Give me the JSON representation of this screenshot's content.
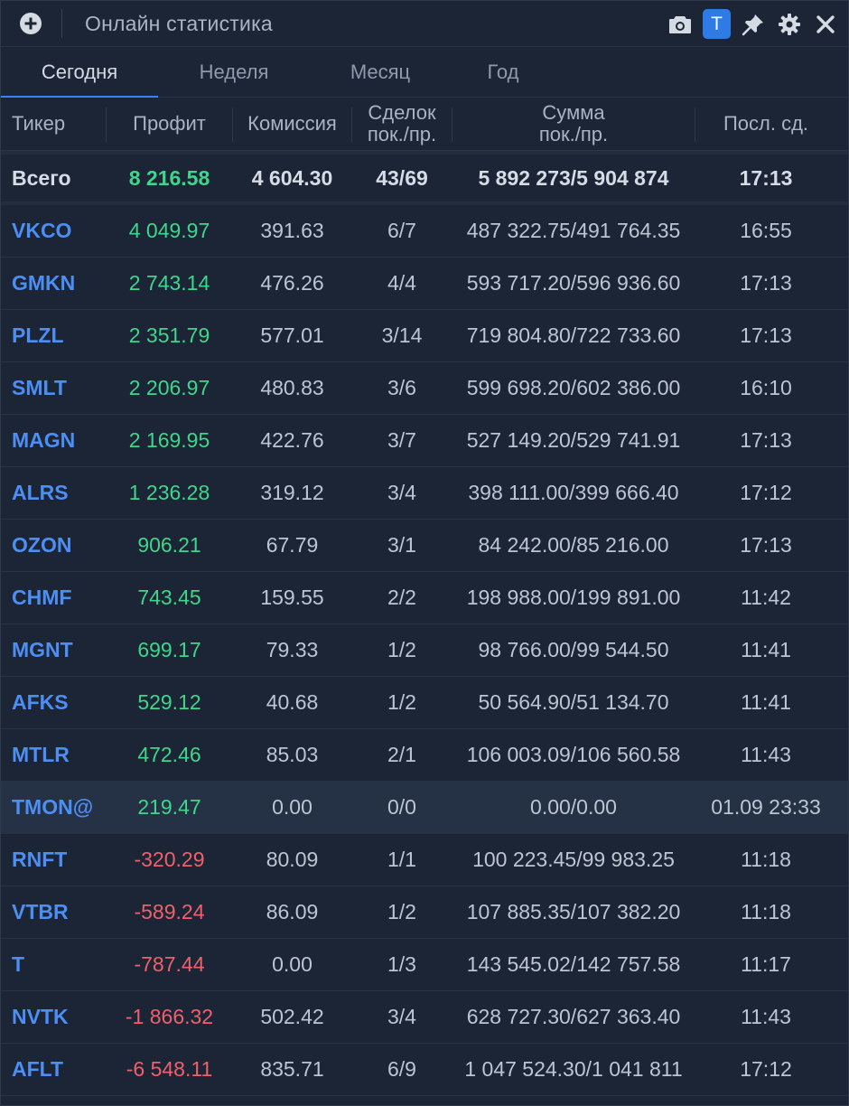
{
  "window": {
    "title": "Онлайн статистика",
    "t_badge": "T"
  },
  "icons": {
    "add": "plus-circle-icon",
    "camera": "camera-icon",
    "pin": "pin-icon",
    "settings": "gear-icon",
    "close": "close-icon"
  },
  "tabs": [
    {
      "label": "Сегодня",
      "active": true
    },
    {
      "label": "Неделя",
      "active": false
    },
    {
      "label": "Месяц",
      "active": false
    },
    {
      "label": "Год",
      "active": false
    }
  ],
  "columns": {
    "ticker": "Тикер",
    "profit": "Профит",
    "commission": "Комиссия",
    "deals_1": "Сделок",
    "deals_2": "пок./пр.",
    "sum_1": "Сумма",
    "sum_2": "пок./пр.",
    "last": "Посл. сд."
  },
  "total": {
    "ticker": "Всего",
    "profit": "8 216.58",
    "commission": "4 604.30",
    "deals": "43/69",
    "sum": "5 892 273/5 904 874",
    "last": "17:13"
  },
  "rows": [
    {
      "ticker": "VKCO",
      "profit": "4 049.97",
      "commission": "391.63",
      "deals": "6/7",
      "sum": "487 322.75/491 764.35",
      "last": "16:55"
    },
    {
      "ticker": "GMKN",
      "profit": "2 743.14",
      "commission": "476.26",
      "deals": "4/4",
      "sum": "593 717.20/596 936.60",
      "last": "17:13"
    },
    {
      "ticker": "PLZL",
      "profit": "2 351.79",
      "commission": "577.01",
      "deals": "3/14",
      "sum": "719 804.80/722 733.60",
      "last": "17:13"
    },
    {
      "ticker": "SMLT",
      "profit": "2 206.97",
      "commission": "480.83",
      "deals": "3/6",
      "sum": "599 698.20/602 386.00",
      "last": "16:10"
    },
    {
      "ticker": "MAGN",
      "profit": "2 169.95",
      "commission": "422.76",
      "deals": "3/7",
      "sum": "527 149.20/529 741.91",
      "last": "17:13"
    },
    {
      "ticker": "ALRS",
      "profit": "1 236.28",
      "commission": "319.12",
      "deals": "3/4",
      "sum": "398 111.00/399 666.40",
      "last": "17:12"
    },
    {
      "ticker": "OZON",
      "profit": "906.21",
      "commission": "67.79",
      "deals": "3/1",
      "sum": "84 242.00/85 216.00",
      "last": "17:13"
    },
    {
      "ticker": "CHMF",
      "profit": "743.45",
      "commission": "159.55",
      "deals": "2/2",
      "sum": "198 988.00/199 891.00",
      "last": "11:42"
    },
    {
      "ticker": "MGNT",
      "profit": "699.17",
      "commission": "79.33",
      "deals": "1/2",
      "sum": "98 766.00/99 544.50",
      "last": "11:41"
    },
    {
      "ticker": "AFKS",
      "profit": "529.12",
      "commission": "40.68",
      "deals": "1/2",
      "sum": "50 564.90/51 134.70",
      "last": "11:41"
    },
    {
      "ticker": "MTLR",
      "profit": "472.46",
      "commission": "85.03",
      "deals": "2/1",
      "sum": "106 003.09/106 560.58",
      "last": "11:43"
    },
    {
      "ticker": "TMON@",
      "profit": "219.47",
      "commission": "0.00",
      "deals": "0/0",
      "sum": "0.00/0.00",
      "last": "01.09 23:33",
      "highlighted": true
    },
    {
      "ticker": "RNFT",
      "profit": "-320.29",
      "commission": "80.09",
      "deals": "1/1",
      "sum": "100 223.45/99 983.25",
      "last": "11:18"
    },
    {
      "ticker": "VTBR",
      "profit": "-589.24",
      "commission": "86.09",
      "deals": "1/2",
      "sum": "107 885.35/107 382.20",
      "last": "11:18"
    },
    {
      "ticker": "T",
      "profit": "-787.44",
      "commission": "0.00",
      "deals": "1/3",
      "sum": "143 545.02/142 757.58",
      "last": "11:17"
    },
    {
      "ticker": "NVTK",
      "profit": "-1 866.32",
      "commission": "502.42",
      "deals": "3/4",
      "sum": "628 727.30/627 363.40",
      "last": "11:43"
    },
    {
      "ticker": "AFLT",
      "profit": "-6 548.11",
      "commission": "835.71",
      "deals": "6/9",
      "sum": "1 047 524.30/1 041 811",
      "last": "17:12"
    }
  ],
  "colors": {
    "background": "#1b2535",
    "accent": "#3b82f0",
    "profit_positive": "#3fd68a",
    "profit_negative": "#f0606c",
    "ticker": "#4d8ef2"
  }
}
